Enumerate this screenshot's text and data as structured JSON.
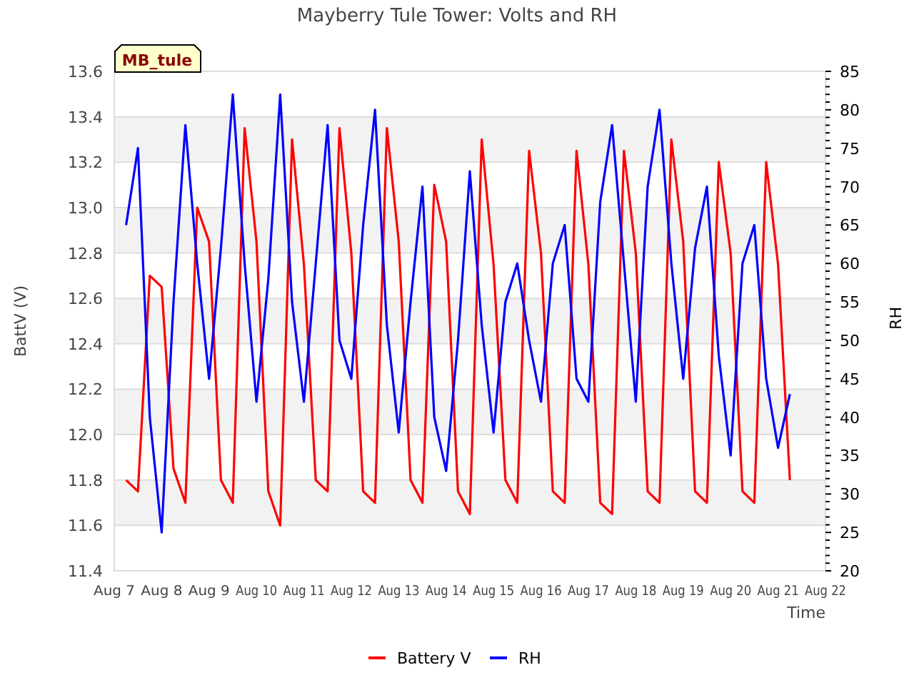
{
  "station_tag": "MB_tule",
  "chart_data": {
    "type": "line",
    "title": "Mayberry Tule Tower: Volts and RH",
    "xlabel": "Time",
    "ylabel": "BattV (V)",
    "y2label": "RH",
    "categories": [
      "Aug 7",
      null,
      null,
      null,
      "Aug 8",
      null,
      null,
      null,
      "Aug 9",
      null,
      null,
      null,
      "Aug 10",
      null,
      null,
      null,
      "Aug 11",
      null,
      null,
      null,
      "Aug 12",
      null,
      null,
      null,
      "Aug 13",
      null,
      null,
      null,
      "Aug 14",
      null,
      null,
      null,
      "Aug 15",
      null,
      null,
      null,
      "Aug 16",
      null,
      null,
      null,
      "Aug 17",
      null,
      null,
      null,
      "Aug 18",
      null,
      null,
      null,
      "Aug 19",
      null,
      null,
      null,
      "Aug 20",
      null,
      null,
      null,
      "Aug 21",
      null,
      null,
      null,
      "Aug 22"
    ],
    "ylim": [
      11.4,
      13.6
    ],
    "yticks": [
      {
        "value": 11.4,
        "label": "11.4"
      },
      {
        "value": 11.6,
        "label": "11.6"
      },
      {
        "value": 11.8,
        "label": "11.8"
      },
      {
        "value": 12.0,
        "label": "12.0"
      },
      {
        "value": 12.2,
        "label": "12.2"
      },
      {
        "value": 12.4,
        "label": "12.4"
      },
      {
        "value": 12.6,
        "label": "12.6"
      },
      {
        "value": 12.8,
        "label": "12.8"
      },
      {
        "value": 13.0,
        "label": "13.0"
      },
      {
        "value": 13.2,
        "label": "13.2"
      },
      {
        "value": 13.4,
        "label": "13.4"
      },
      {
        "value": 13.6,
        "label": "13.6"
      }
    ],
    "y2lim": [
      20,
      85
    ],
    "grid": true,
    "legend": "bottom",
    "y2ticks": [
      20,
      25,
      30,
      35,
      40,
      45,
      50,
      55,
      60,
      65,
      70,
      75,
      80,
      85
    ],
    "series": [
      {
        "name": "Battery V",
        "color": "#ff0000",
        "values": [
          null,
          11.8,
          11.75,
          12.7,
          12.65,
          11.85,
          11.7,
          13.0,
          12.85,
          11.8,
          11.7,
          13.35,
          12.85,
          11.75,
          11.6,
          13.3,
          12.75,
          11.8,
          11.75,
          13.35,
          12.8,
          11.75,
          11.7,
          13.35,
          12.85,
          11.8,
          11.7,
          13.1,
          12.85,
          11.75,
          11.65,
          13.3,
          12.75,
          11.8,
          11.7,
          13.25,
          12.8,
          11.75,
          11.7,
          13.25,
          12.75,
          11.7,
          11.65,
          13.25,
          12.8,
          11.75,
          11.7,
          13.3,
          12.85,
          11.75,
          11.7,
          13.2,
          12.8,
          11.75,
          11.7,
          13.2,
          12.75,
          11.8,
          null,
          null,
          null
        ]
      },
      {
        "name": "RH",
        "color": "#0000ff",
        "axis": "y2",
        "values": [
          null,
          65,
          75,
          40,
          25,
          55,
          78,
          60,
          45,
          62,
          82,
          60,
          42,
          58,
          82,
          55,
          42,
          60,
          78,
          50,
          45,
          65,
          80,
          52,
          38,
          55,
          70,
          40,
          33,
          50,
          72,
          52,
          38,
          55,
          60,
          50,
          42,
          60,
          65,
          45,
          42,
          68,
          78,
          60,
          42,
          70,
          80,
          60,
          45,
          62,
          70,
          48,
          35,
          60,
          65,
          45,
          36,
          43,
          null,
          null,
          null
        ]
      }
    ]
  }
}
